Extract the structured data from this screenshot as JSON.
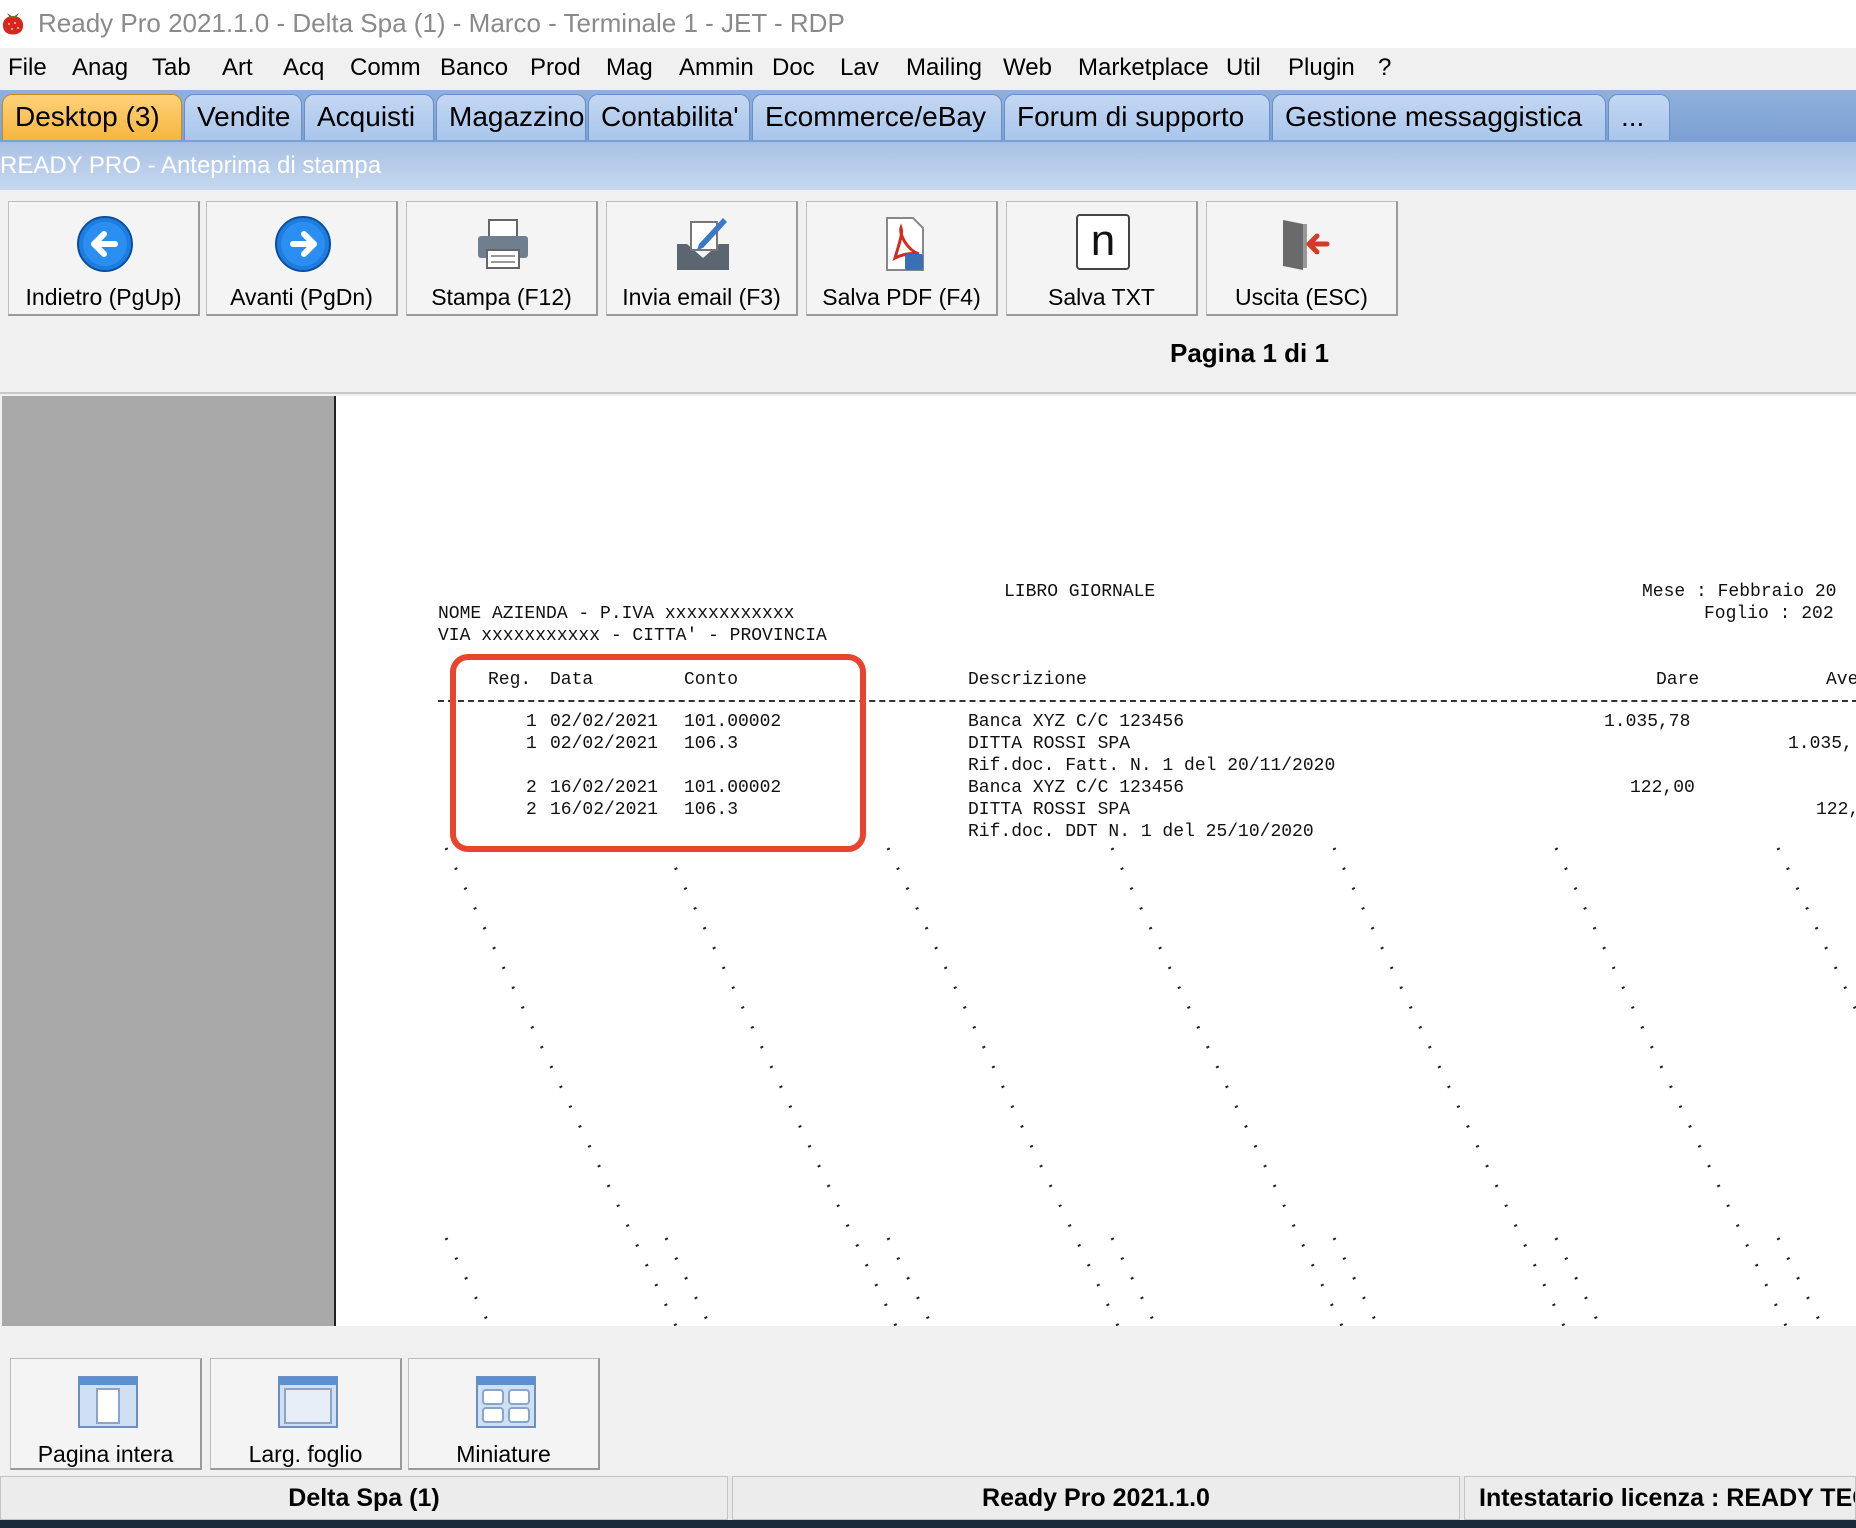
{
  "window": {
    "title": "Ready Pro 2021.1.0 - Delta Spa (1) - Marco - Terminale 1 - JET - RDP"
  },
  "menu": [
    "File",
    "Anag",
    "Tab",
    "Art",
    "Acq",
    "Comm",
    "Banco",
    "Prod",
    "Mag",
    "Ammin",
    "Doc",
    "Lav",
    "Mailing",
    "Web",
    "Marketplace",
    "Util",
    "Plugin",
    "?"
  ],
  "tabs": [
    "Desktop (3)",
    "Vendite",
    "Acquisti",
    "Magazzino",
    "Contabilita'",
    "Ecommerce/eBay",
    "Forum di supporto",
    "Gestione messaggistica",
    "..."
  ],
  "subheader": "READY PRO - Anteprima di stampa",
  "toolbar": {
    "back": "Indietro (PgUp)",
    "forward": "Avanti (PgDn)",
    "print": "Stampa (F12)",
    "email": "Invia email (F3)",
    "pdf": "Salva PDF (F4)",
    "txt": "Salva TXT",
    "exit": "Uscita (ESC)",
    "txt_glyph": "n"
  },
  "page_info": "Pagina 1 di 1",
  "report": {
    "title": "LIBRO GIORNALE",
    "company_line1": "NOME AZIENDA - P.IVA xxxxxxxxxxxx",
    "company_line2": "VIA xxxxxxxxxxx - CITTA' - PROVINCIA",
    "mese": "Mese : Febbraio 20",
    "foglio": "Foglio : 202",
    "headers": {
      "reg": "Reg.",
      "data": "Data",
      "conto": "Conto",
      "descrizione": "Descrizione",
      "dare": "Dare",
      "avere": "Ave"
    },
    "rows": [
      {
        "reg": "1",
        "data": "02/02/2021",
        "conto": "101.00002",
        "descrizione": "Banca XYZ C/C 123456",
        "dare": "1.035,78",
        "avere": ""
      },
      {
        "reg": "1",
        "data": "02/02/2021",
        "conto": "106.3",
        "descrizione": "DITTA ROSSI SPA",
        "dare": "",
        "avere": "1.035,"
      },
      {
        "reg": "",
        "data": "",
        "conto": "",
        "descrizione": "Rif.doc. Fatt. N. 1 del 20/11/2020",
        "dare": "",
        "avere": ""
      },
      {
        "reg": "2",
        "data": "16/02/2021",
        "conto": "101.00002",
        "descrizione": "Banca XYZ C/C 123456",
        "dare": "122,00",
        "avere": ""
      },
      {
        "reg": "2",
        "data": "16/02/2021",
        "conto": "106.3",
        "descrizione": "DITTA ROSSI SPA",
        "dare": "",
        "avere": "122,"
      },
      {
        "reg": "",
        "data": "",
        "conto": "",
        "descrizione": "Rif.doc. DDT N. 1 del 25/10/2020",
        "dare": "",
        "avere": ""
      }
    ]
  },
  "bottom_buttons": {
    "full_page": "Pagina intera",
    "page_width": "Larg. foglio",
    "thumbnails": "Miniature"
  },
  "status": {
    "company": "Delta Spa (1)",
    "version": "Ready Pro 2021.1.0",
    "license": "Intestatario licenza : READY TEC"
  },
  "colors": {
    "highlight": "#e8442e",
    "active_tab": "#f6b53f",
    "tab": "#a9c6ec"
  }
}
